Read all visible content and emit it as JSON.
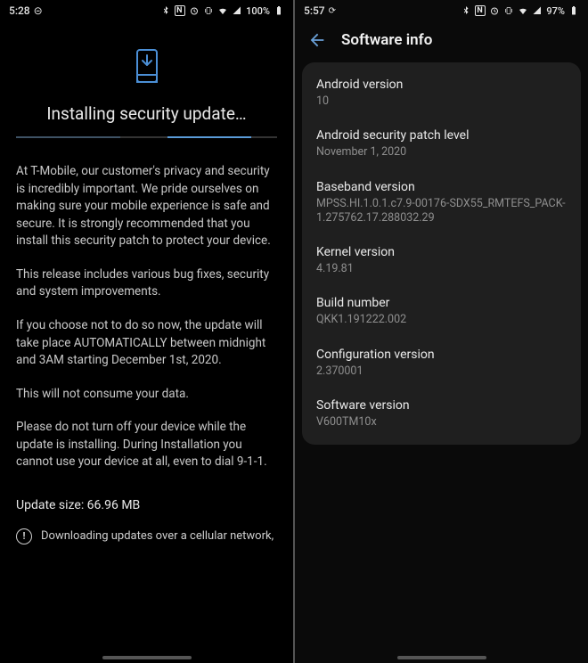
{
  "left": {
    "status": {
      "time": "5:28",
      "dnd_icon": "⊝",
      "battery_text": "100%",
      "icons": [
        "bt",
        "nfc",
        "alarm",
        "vibrate",
        "wifi",
        "signal"
      ]
    },
    "title": "Installing security update…",
    "paragraphs": [
      "At T-Mobile, our customer's privacy and security is incredibly important. We pride ourselves on making sure your mobile experience is safe and secure. It is strongly recommended that you install this security patch to protect your device.",
      "This release includes various bug fixes, security and system improvements.",
      "If you choose not to do so now, the update will take place AUTOMATICALLY between midnight and 3AM starting December 1st, 2020.",
      "This will not consume your data.",
      "Please do not turn off your device while the update is installing. During Installation you cannot use your device at all, even to dial 9-1-1."
    ],
    "update_size": "Update size: 66.96 MB",
    "cellular_note": "Downloading updates over a cellular network,"
  },
  "right": {
    "status": {
      "time": "5:57",
      "sync_icon": "◔",
      "battery_text": "97%",
      "icons": [
        "bt",
        "nfc",
        "alarm",
        "vibrate",
        "wifi",
        "signal"
      ]
    },
    "appbar_title": "Software info",
    "rows": [
      {
        "label": "Android version",
        "value": "10"
      },
      {
        "label": "Android security patch level",
        "value": "November 1, 2020"
      },
      {
        "label": "Baseband version",
        "value": "MPSS.HI.1.0.1.c7.9-00176-SDX55_RMTEFS_PACK-1.275762.17.288032.29"
      },
      {
        "label": "Kernel version",
        "value": "4.19.81"
      },
      {
        "label": "Build number",
        "value": "QKK1.191222.002"
      },
      {
        "label": "Configuration version",
        "value": "2.370001"
      },
      {
        "label": "Software version",
        "value": "V600TM10x"
      }
    ]
  }
}
